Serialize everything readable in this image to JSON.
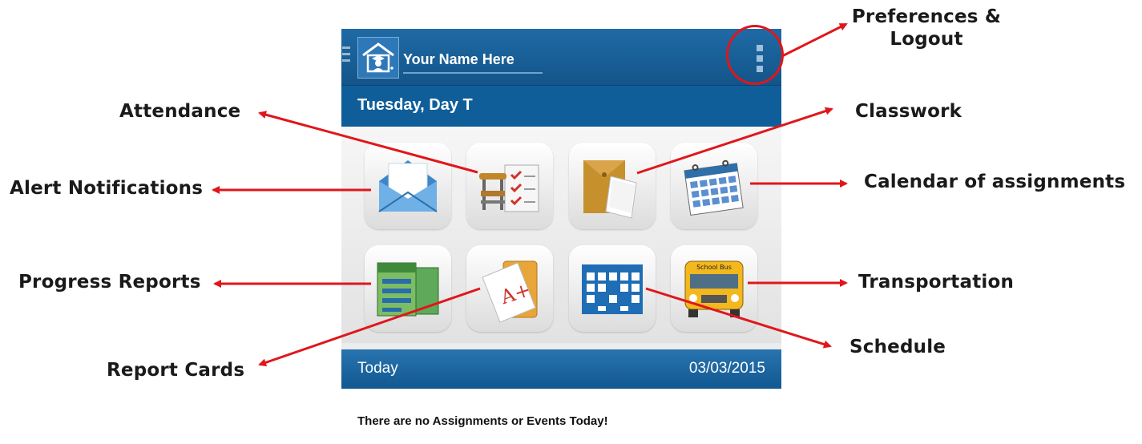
{
  "app": {
    "user_name": "Your Name Here",
    "day_title": "Tuesday, Day T",
    "footer_label": "Today",
    "footer_date": "03/03/2015",
    "empty_message": "There are no Assignments or Events Today!",
    "tiles": [
      {
        "name": "alert-notifications",
        "icon": "envelope-icon"
      },
      {
        "name": "attendance",
        "icon": "desk-checklist-icon"
      },
      {
        "name": "classwork",
        "icon": "folder-paper-icon"
      },
      {
        "name": "calendar",
        "icon": "calendar-icon"
      },
      {
        "name": "progress-reports",
        "icon": "reports-icon"
      },
      {
        "name": "report-cards",
        "icon": "report-card-icon"
      },
      {
        "name": "schedule",
        "icon": "schedule-grid-icon"
      },
      {
        "name": "transportation",
        "icon": "school-bus-icon"
      }
    ],
    "bus_text": "School Bus"
  },
  "callouts": {
    "preferences_line1": "Preferences &",
    "preferences_line2": "Logout",
    "attendance": "Attendance",
    "classwork": "Classwork",
    "alert_notifications": "Alert Notifications",
    "calendar": "Calendar of assignments",
    "progress_reports": "Progress Reports",
    "transportation": "Transportation",
    "schedule": "Schedule",
    "report_cards": "Report Cards"
  },
  "colors": {
    "header_blue": "#135589",
    "day_bar_blue": "#0f5e99",
    "annotation_red": "#e0161b",
    "tile_background": "#ececec"
  }
}
